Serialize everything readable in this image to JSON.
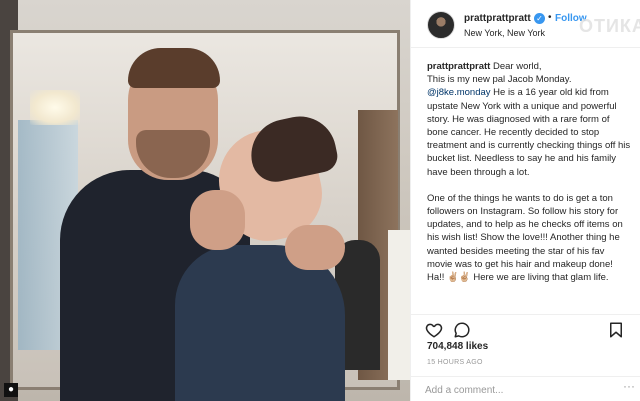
{
  "post": {
    "username": "prattprattpratt",
    "follow_label": "Follow",
    "location": "New York, New York",
    "watermark": "ОТИКА",
    "caption": {
      "username": "prattprattpratt",
      "p1_start": "Dear world,",
      "p1_line2": "This is my new pal Jacob Monday.",
      "mention": "@j8ke.monday",
      "p1_rest": "He is a 16 year old kid from upstate New York with a unique and powerful story. He was diagnosed with a rare form of bone cancer. He recently decided to stop treatment and is currently checking things off his bucket list. Needless to say he and his family have been through a lot.",
      "p2": "One of the things he wants to do is get a ton followers on Instagram. So follow his story for updates, and to help as he checks off items on his wish list! Show the love!!! Another thing he wanted besides meeting the star of his fav movie was to get his hair and makeup done! Ha!! ✌🏼✌🏼 Here we are living that glam life."
    },
    "likes": "704,848 likes",
    "timestamp": "15 HOURS AGO",
    "comment_placeholder": "Add a comment...",
    "more_glyph": "···"
  },
  "icons": {
    "verified": "verified-badge-icon",
    "like": "heart-icon",
    "comment": "speech-bubble-icon",
    "save": "bookmark-icon",
    "more": "more-options-icon"
  },
  "colors": {
    "accent": "#3897f0",
    "mention": "#003569",
    "muted": "#999999",
    "text": "#262626",
    "divider": "#efefef"
  }
}
